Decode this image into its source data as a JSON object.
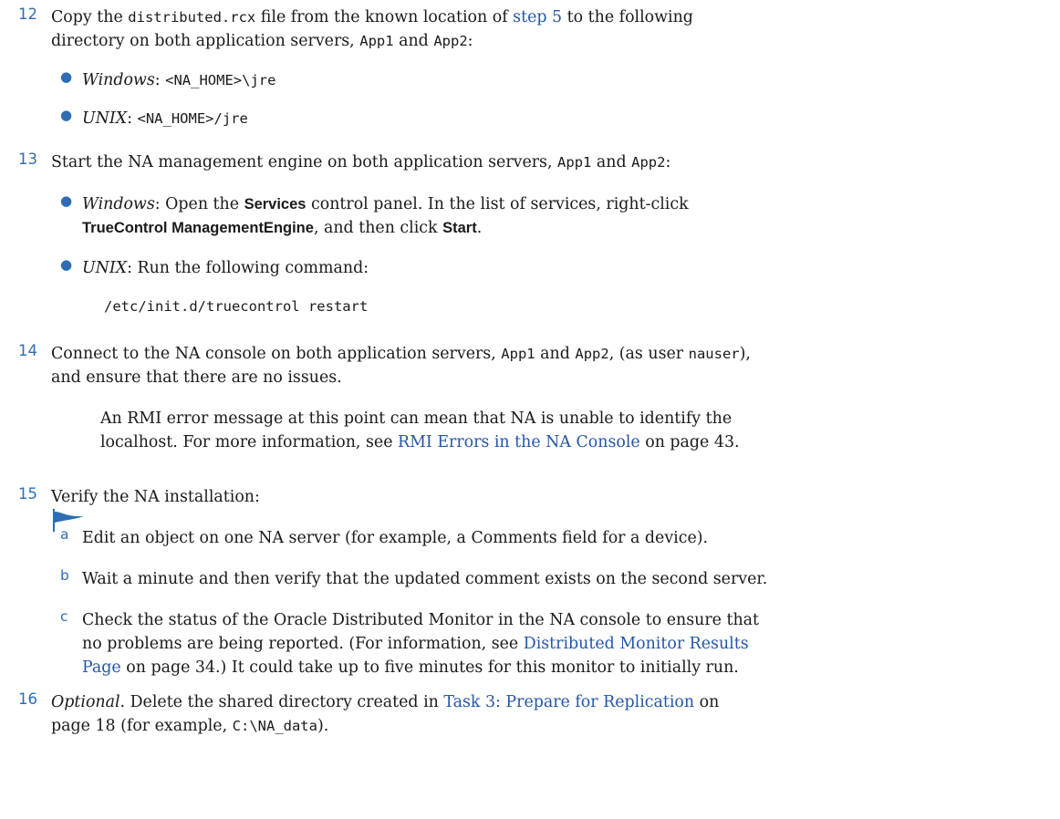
{
  "step12": {
    "number": "12",
    "p1": "Copy the ",
    "file": "distributed.rcx",
    "p2": " file from the known location of ",
    "link": "step 5",
    "p3": " to the following",
    "p4": "directory on both application servers, ",
    "app1": "App1",
    "and": " and ",
    "app2": "App2",
    "colon": ":",
    "bullets": [
      {
        "label": "Windows",
        "sep": ": ",
        "path": "<NA_HOME>\\jre"
      },
      {
        "label": "UNIX",
        "sep": ": ",
        "path": "<NA_HOME>/jre"
      }
    ]
  },
  "step13": {
    "number": "13",
    "p1": "Start the NA management engine on both application servers, ",
    "app1": "App1",
    "and": " and ",
    "app2": "App2",
    "colon": ":",
    "win_label": "Windows",
    "win_p1": ": Open the ",
    "win_services": "Services",
    "win_p2": " control panel. In the list of services, right-click",
    "win_tc": "TrueControl ManagementEngine",
    "win_p3": ", and then click ",
    "win_start": "Start",
    "win_p4": ".",
    "unix_label": "UNIX",
    "unix_text": ": Run the following command:",
    "command": "/etc/init.d/truecontrol restart"
  },
  "step14": {
    "number": "14",
    "p1": "Connect to the NA console on both application servers, ",
    "app1": "App1",
    "and": " and ",
    "app2": "App2",
    "p2": ", (as user ",
    "user": "nauser",
    "p3": "),",
    "p4": "and ensure that there are no issues.",
    "note_p1": "An RMI error message at this point can mean that NA is unable to identify the",
    "note_p2": "localhost. For more information, see ",
    "note_link": "RMI Errors in the NA Console",
    "note_p3": " on page 43."
  },
  "step15": {
    "number": "15",
    "text": "Verify the NA installation:",
    "a_letter": "a",
    "a_text": "Edit an object on one NA server (for example, a Comments field for a device).",
    "b_letter": "b",
    "b_text": "Wait a minute and then verify that the updated comment exists on the second server.",
    "c_letter": "c",
    "c_l1": "Check the status of the Oracle Distributed Monitor in the NA console to ensure that",
    "c_l2a": "no problems are being reported. (For information, see ",
    "c_link1": "Distributed Monitor Results",
    "c_link2": "Page",
    "c_l3": " on page 34.) It could take up to five minutes for this monitor to initially run."
  },
  "step16": {
    "number": "16",
    "optional": "Optional",
    "p1": ". Delete the shared directory created in ",
    "link": "Task 3: Prepare for Replication",
    "p2": " on",
    "p3": "page 18 (for example, ",
    "path": "C:\\NA_data",
    "p4": ")."
  },
  "colors": {
    "accent": "#2e6db4",
    "link": "#2456a8",
    "text": "#1a1a1a"
  },
  "icons": {
    "note": "note-pointer-icon"
  }
}
